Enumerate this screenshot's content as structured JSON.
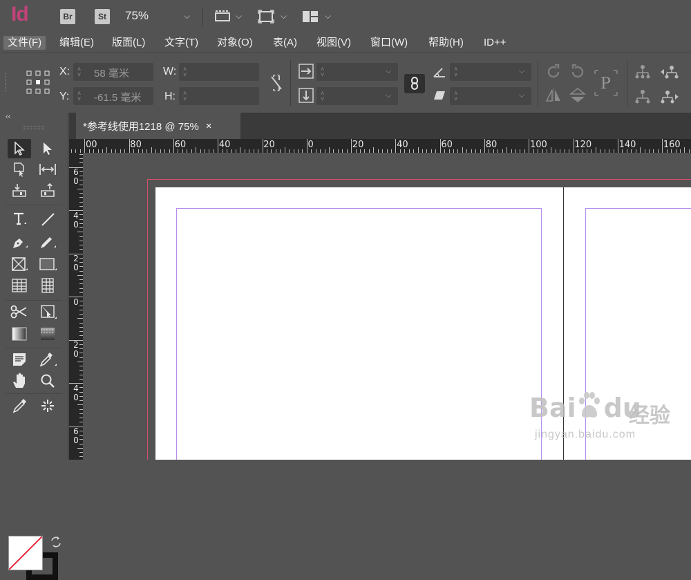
{
  "app": {
    "logo": "Id",
    "bridge_badge": "Br",
    "stock_badge": "St",
    "zoom": "75%"
  },
  "menu": [
    {
      "label": "文件(F)"
    },
    {
      "label": "编辑(E)"
    },
    {
      "label": "版面(L)"
    },
    {
      "label": "文字(T)"
    },
    {
      "label": "对象(O)"
    },
    {
      "label": "表(A)"
    },
    {
      "label": "视图(V)"
    },
    {
      "label": "窗口(W)"
    },
    {
      "label": "帮助(H)"
    },
    {
      "label": "ID++"
    }
  ],
  "control": {
    "x_label": "X:",
    "x_value": "58 毫米",
    "y_label": "Y:",
    "y_value": "-61.5 毫米",
    "w_label": "W:",
    "w_value": "",
    "h_label": "H:",
    "h_value": ""
  },
  "document_tab": {
    "title": "*参考线使用1218 @ 75%",
    "close": "×"
  },
  "ruler": {
    "horizontal": [
      "00",
      "80",
      "60",
      "40",
      "20",
      "0",
      "20",
      "40",
      "60",
      "80",
      "100",
      "120",
      "140",
      "160"
    ],
    "vertical": [
      {
        "d1": "6",
        "d2": "0"
      },
      {
        "d1": "4",
        "d2": "0"
      },
      {
        "d1": "2",
        "d2": "0"
      },
      {
        "d1": "0",
        "d2": ""
      },
      {
        "d1": "2",
        "d2": "0"
      },
      {
        "d1": "4",
        "d2": "0"
      },
      {
        "d1": "6",
        "d2": "0"
      }
    ]
  },
  "watermark": {
    "brand": "Bai",
    "brand2": "du",
    "cn": "经验",
    "url": "jingyan.baidu.com"
  },
  "colors": {
    "bleed": "#d8506a",
    "margin": "#b48df0",
    "logo": "#c2437a"
  }
}
